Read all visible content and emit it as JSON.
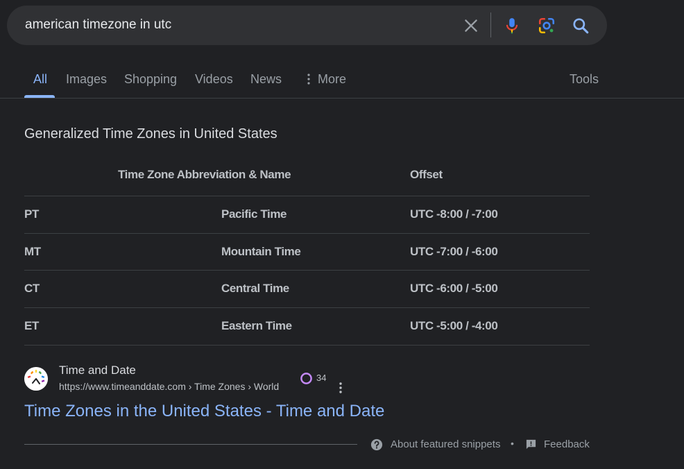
{
  "search": {
    "query": "american timezone in utc"
  },
  "tabs": [
    {
      "label": "All",
      "active": true
    },
    {
      "label": "Images"
    },
    {
      "label": "Shopping"
    },
    {
      "label": "Videos"
    },
    {
      "label": "News"
    },
    {
      "label": "More"
    }
  ],
  "tools_label": "Tools",
  "snippet": {
    "title": "Generalized Time Zones in United States",
    "headers": {
      "name": "Time Zone Abbreviation & Name",
      "offset": "Offset"
    },
    "rows": [
      {
        "abbr": "PT",
        "name": "Pacific Time",
        "offset": "UTC -8:00 / -7:00"
      },
      {
        "abbr": "MT",
        "name": "Mountain Time",
        "offset": "UTC -7:00 / -6:00"
      },
      {
        "abbr": "CT",
        "name": "Central Time",
        "offset": "UTC -6:00 / -5:00"
      },
      {
        "abbr": "ET",
        "name": "Eastern Time",
        "offset": "UTC -5:00 / -4:00"
      }
    ]
  },
  "result": {
    "site_name": "Time and Date",
    "url": "https://www.timeanddate.com › Time Zones › World",
    "rating_count": "34",
    "title": "Time Zones in the United States - Time and Date"
  },
  "footer": {
    "about": "About featured snippets",
    "separator": "•",
    "feedback": "Feedback"
  },
  "colors": {
    "background": "#202124",
    "accent": "#8ab4f8",
    "rating_ring": "#c58af9"
  }
}
